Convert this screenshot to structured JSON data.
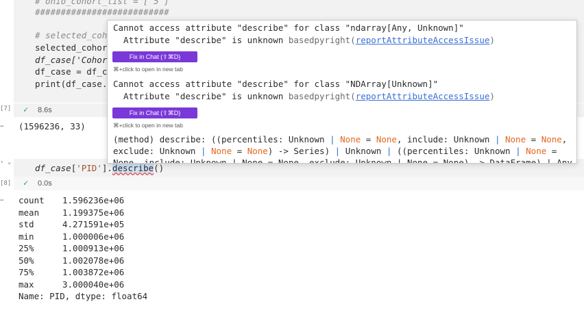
{
  "cell7": {
    "lines": [
      "# ohio_cohort_list = [ 5 ]",
      "##########################",
      "",
      "# selected_coho",
      "selected_cohort",
      "df_case['Cohort",
      "df_case = df_ca",
      "print(df_case.s"
    ],
    "exec_number": "[7]",
    "exec_time": "8.6s",
    "output": "(1596236, 33)"
  },
  "cell8": {
    "exec_number": "[8]",
    "code_prefix": "df_case",
    "code_bracket_open": "[",
    "code_string": "'PID'",
    "code_bracket_close": "].",
    "code_method": "describe",
    "code_parens": "()",
    "exec_time": "0.0s",
    "output_rows": [
      {
        "label": "count",
        "value": "1.596236e+06"
      },
      {
        "label": "mean",
        "value": "1.199375e+06"
      },
      {
        "label": "std",
        "value": "4.271591e+05"
      },
      {
        "label": "min",
        "value": "1.000006e+06"
      },
      {
        "label": "25%",
        "value": "1.000913e+06"
      },
      {
        "label": "50%",
        "value": "1.002078e+06"
      },
      {
        "label": "75%",
        "value": "1.003872e+06"
      },
      {
        "label": "max",
        "value": "3.000040e+06"
      }
    ],
    "output_footer": "Name: PID, dtype: float64"
  },
  "hover": {
    "error1_title": "Cannot access attribute \"describe\" for class \"ndarray[Any, Unknown]\"",
    "error1_detail": "  Attribute \"describe\" is unknown ",
    "error1_source": "basedpyright(",
    "error1_link": "reportAttributeAccessIssue",
    "error1_close": ")",
    "fix_button_1": "Fix in Chat (⇧⌘D)",
    "hint_1": "⌘+click to open in new tab",
    "error2_title": "Cannot access attribute \"describe\" for class \"NDArray[Unknown]\"",
    "error2_detail": "  Attribute \"describe\" is unknown ",
    "error2_source": "basedpyright(",
    "error2_link": "reportAttributeAccessIssue",
    "error2_close": ")",
    "fix_button_2": "Fix in Chat (⇧⌘D)",
    "hint_2": "⌘+click to open in new tab",
    "sig_a1": "(method) describe: ((percentiles: Unknown ",
    "sig_a2": "| ",
    "sig_a3": "None",
    "sig_a4": " = ",
    "sig_a5": "None",
    "sig_a6": ", include: Unknown ",
    "sig_a7": "| ",
    "sig_a8": "None",
    "sig_a9": " = ",
    "sig_a10": "None",
    "sig_a11": ",",
    "sig_b1": "exclude: Unknown ",
    "sig_b2": "| ",
    "sig_b3": "None",
    "sig_b4": " = ",
    "sig_b5": "None",
    "sig_b6": ") -> Series) ",
    "sig_b7": "| ",
    "sig_b8": "Unknown ",
    "sig_b9": "| ",
    "sig_b10": "((percentiles: Unknown ",
    "sig_b11": "| ",
    "sig_b12": "None",
    "sig_b13": " =",
    "sig_c": "None, include: Unknown | None = None, exclude: Unknown | None = None) -> DataFrame) | Any"
  },
  "colors": {
    "accent": "#7a38d8",
    "link": "#3a6fd8",
    "none_keyword": "#e5661d",
    "success": "#2aa05a"
  }
}
